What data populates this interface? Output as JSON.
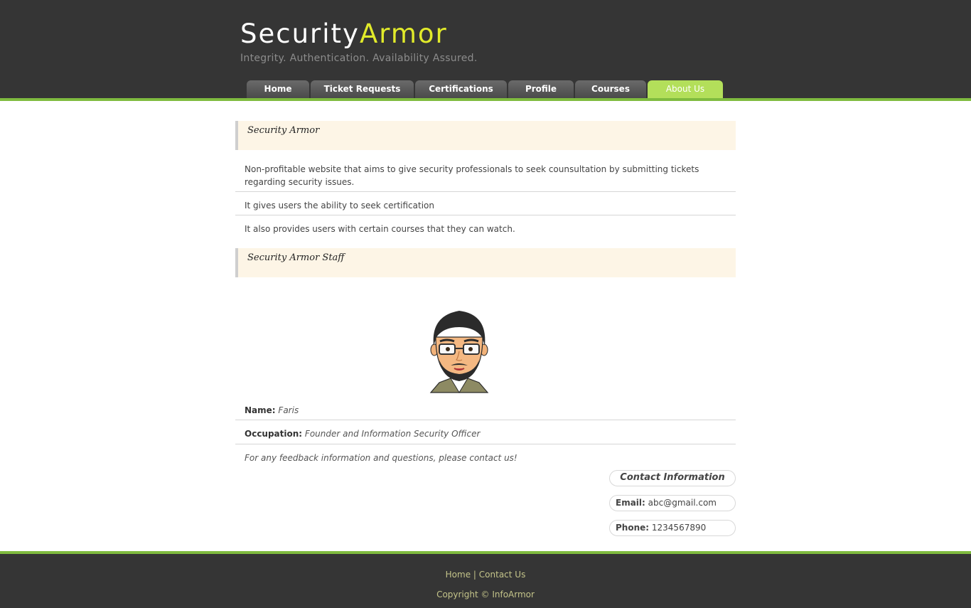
{
  "header": {
    "logo_part1": "Security",
    "logo_part2": "Armor",
    "slogan": "Integrity. Authentication. Availability Assured."
  },
  "nav": {
    "tabs": [
      {
        "label": "Home"
      },
      {
        "label": "Ticket Requests"
      },
      {
        "label": "Certifications"
      },
      {
        "label": "Profile"
      },
      {
        "label": "Courses"
      },
      {
        "label": "About Us",
        "active": true
      }
    ]
  },
  "about": {
    "heading": "Security Armor",
    "paragraphs": [
      "Non-profitable website that aims to give security professionals to seek counsultation by submitting tickets regarding security issues.",
      "It gives users the ability to seek certification",
      "It also provides users with certain courses that they can watch."
    ]
  },
  "staff": {
    "heading": "Security Armor Staff",
    "name_label": "Name:",
    "name_value": "Faris",
    "occupation_label": "Occupation:",
    "occupation_value": "Founder and Information Security Officer",
    "feedback": "For any feedback information and questions, please contact us!"
  },
  "contact": {
    "title": "Contact Information",
    "email_label": "Email:",
    "email_value": "abc@gmail.com",
    "phone_label": "Phone:",
    "phone_value": "1234567890"
  },
  "footer": {
    "home": "Home",
    "separator": "|",
    "contact": "Contact Us",
    "copyright": "Copyright © InfoArmor"
  },
  "colors": {
    "header_bg": "#353535",
    "accent_green": "#7fbb3f",
    "logo_yellow": "#e1ea2a",
    "active_tab": "#b3df5a",
    "section_bg": "#fdf5e6"
  }
}
